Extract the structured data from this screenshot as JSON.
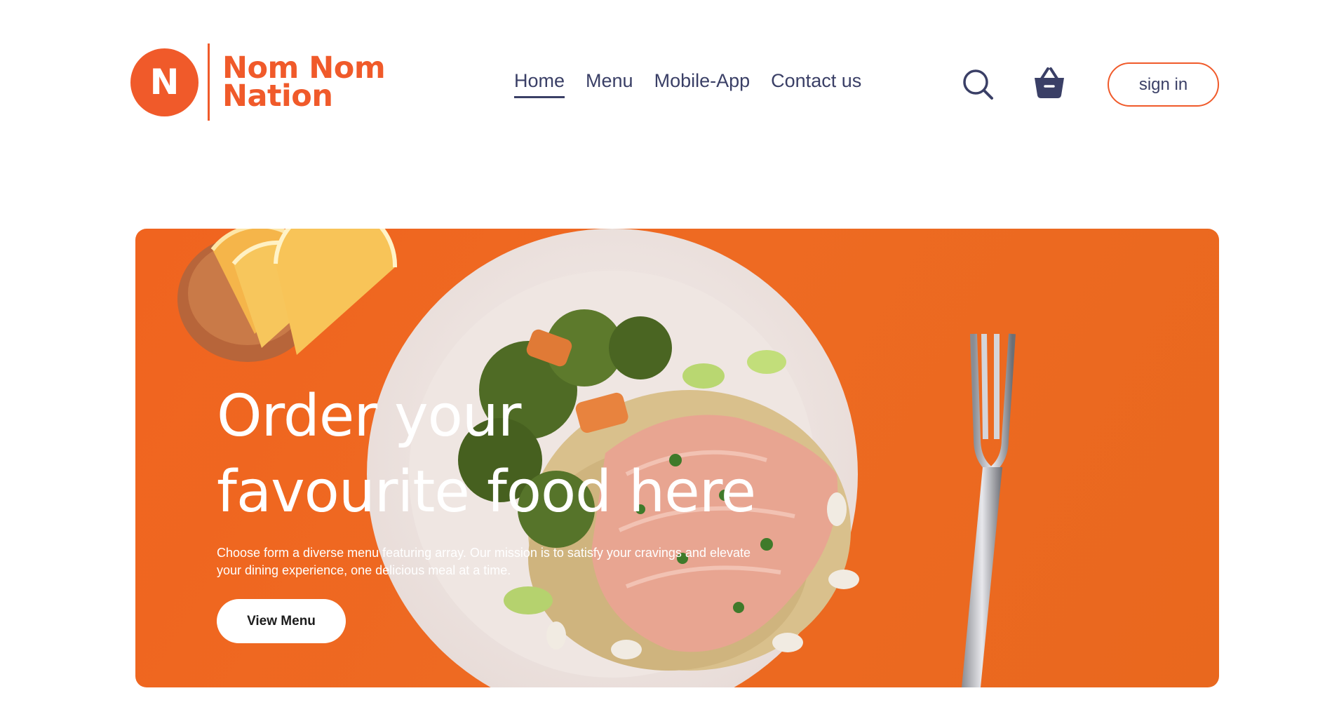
{
  "brand": {
    "logo_letter": "N",
    "name_line1": "Nom Nom",
    "name_line2": "Nation",
    "color": "#f05a2a"
  },
  "nav": {
    "items": [
      {
        "label": "Home",
        "active": true
      },
      {
        "label": "Menu",
        "active": false
      },
      {
        "label": "Mobile-App",
        "active": false
      },
      {
        "label": "Contact us",
        "active": false
      }
    ],
    "text_color": "#3a3f66"
  },
  "header_actions": {
    "search_icon": "search-icon",
    "cart_icon": "basket-icon",
    "signin_label": "sign in"
  },
  "hero": {
    "title_line1": "Order your",
    "title_line2": "favourite food here",
    "description": "Choose form a diverse menu featuring array. Our mission is to satisfy your cravings and elevate your dining experience, one delicious meal at a time.",
    "cta_label": "View Menu",
    "background_color": "#ee6a22"
  }
}
